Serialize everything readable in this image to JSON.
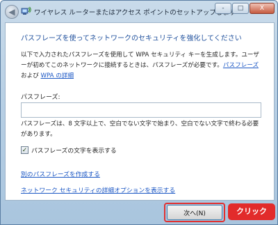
{
  "window": {
    "title": "ワイヤレス ルーターまたはアクセス ポイントのセットアップします",
    "minimize_label": "-",
    "maximize_label": "□",
    "close_label": "X",
    "back_label": "◀"
  },
  "main": {
    "heading": "パスフレーズを使ってネットワークのセキュリティを強化してください",
    "description": "以下で入力されたパスフレーズを使用して WPA セキュリティ キーを生成します。ユーザーが初めてこのネットワークに接続するときは、パスフレーズが必要です。",
    "link_passphrase": "パスフレーズ",
    "conjunction": " および ",
    "link_wpa_details": "WPA の詳細",
    "passphrase_label": "パスフレーズ:",
    "passphrase_value": "",
    "hint": "パスフレーズは、8 文字以上で、空白でない文字で始まり、空白でない文字で終わる必要があります。",
    "show_chars_label": "パスフレーズの文字を表示する",
    "show_chars_checked": true,
    "link_create_other": "別のパスフレーズを作成する",
    "link_advanced": "ネットワーク セキュリティの詳細オプションを表示する"
  },
  "footer": {
    "next_button": "次へ(N)",
    "callout": "クリック"
  },
  "colors": {
    "heading": "#1e4f9c",
    "link": "#1a56c4",
    "callout": "#e22b2b"
  }
}
